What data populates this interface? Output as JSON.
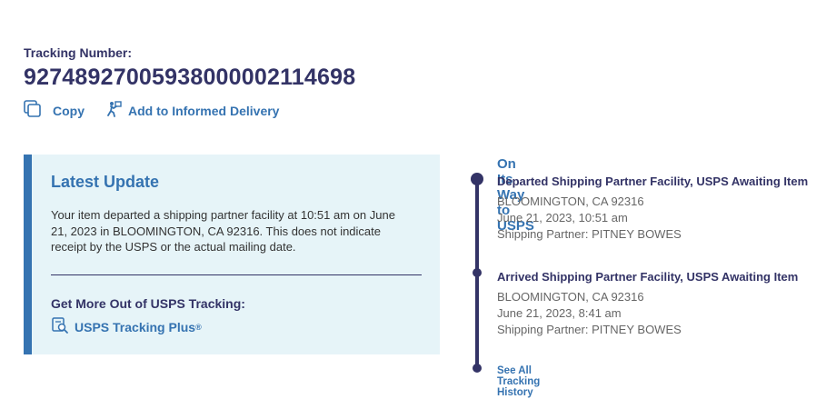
{
  "tracking": {
    "label": "Tracking Number:",
    "number": "9274892700593800000211469​8"
  },
  "actions": {
    "copy_label": "Copy",
    "informed_label": "Add to Informed Delivery",
    "copy_icon": "copy-icon",
    "informed_icon": "informed-delivery-icon"
  },
  "latest": {
    "heading": "Latest Update",
    "message": "Your item departed a shipping partner facility at 10:51 am on June 21, 2023 in BLOOMINGTON, CA 92316. This does not indicate receipt by the USPS or the actual mailing date.",
    "more_heading": "Get More Out of USPS Tracking:",
    "plus_label": "USPS Tracking Plus",
    "plus_mark": "®",
    "plus_icon": "tracking-plus-icon"
  },
  "timeline": {
    "status": "On Its Way to USPS",
    "events": [
      {
        "title": "Departed Shipping Partner Facility, USPS Awaiting Item",
        "location": "BLOOMINGTON, CA 92316",
        "datetime": "June 21, 2023, 10:51 am",
        "partner": "Shipping Partner: PITNEY BOWES"
      },
      {
        "title": "Arrived Shipping Partner Facility, USPS Awaiting Item",
        "location": "BLOOMINGTON, CA 92316",
        "datetime": "June 21, 2023, 8:41 am",
        "partner": "Shipping Partner: PITNEY BOWES"
      }
    ],
    "history_link": "See All Tracking History"
  },
  "colors": {
    "navy": "#333366",
    "link_blue": "#3573b1",
    "panel_bg": "#e6f4f8"
  }
}
